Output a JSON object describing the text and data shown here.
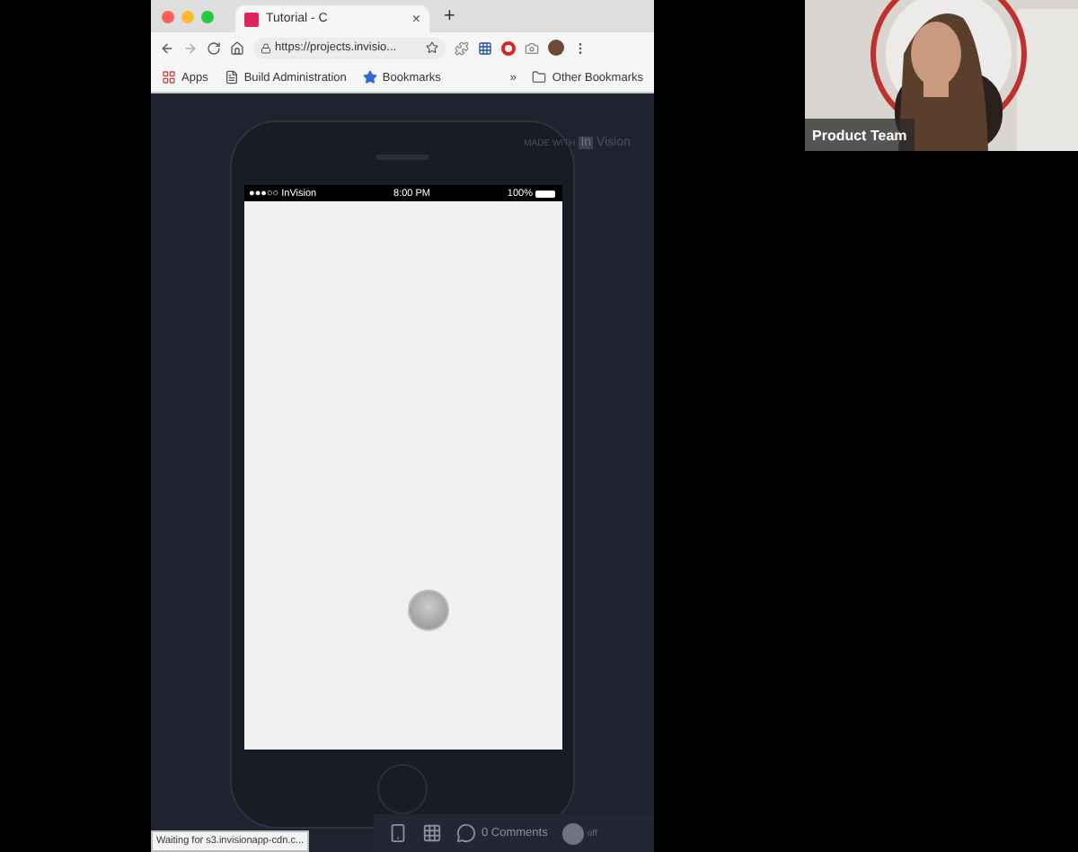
{
  "browser": {
    "tab": {
      "title": "Tutorial - C",
      "close": "×"
    },
    "new_tab": "+",
    "address": {
      "value": "https://projects.invisio..."
    },
    "bookmarks": [
      {
        "kind": "apps",
        "label": "Apps"
      },
      {
        "kind": "page",
        "label": "Build Administration"
      },
      {
        "kind": "star",
        "label": "Bookmarks"
      }
    ],
    "overflow": "»",
    "other_bookmarks": "Other Bookmarks",
    "page": {
      "made_with": "MADE WITH",
      "brand_mark": "In",
      "brand": "Vision",
      "phone": {
        "carrier": "●●●○○ InVision",
        "time": "8:00 PM",
        "battery": "100%"
      },
      "toolbar": {
        "comments": "0 Comments",
        "toggle": {
          "on": false,
          "label": "off"
        }
      }
    },
    "status": "Waiting for s3.invisionapp-cdn.c..."
  },
  "video": {
    "name": "Product Team"
  }
}
